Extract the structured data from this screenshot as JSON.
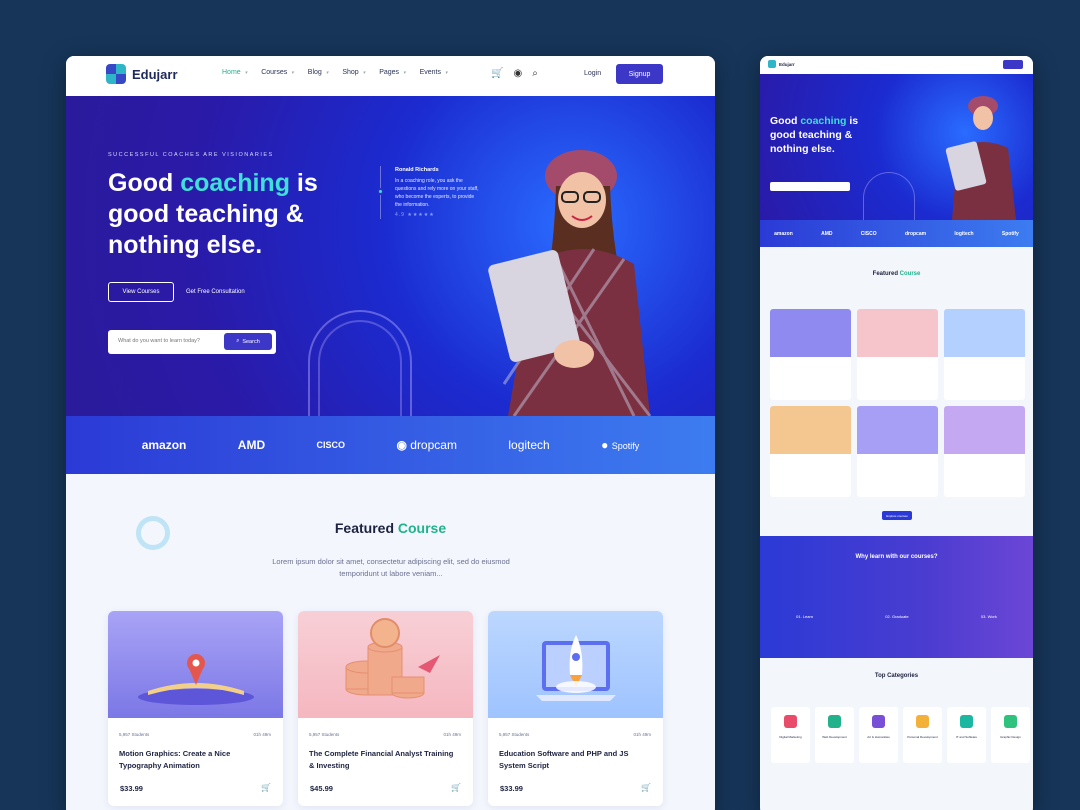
{
  "nav": {
    "logo": "Edujarr",
    "menu": [
      "Home",
      "Courses",
      "Blog",
      "Shop",
      "Pages",
      "Events"
    ],
    "login": "Login",
    "signup": "Signup"
  },
  "hero": {
    "eyebrow": "SUCCESSFUL COACHES ARE VISIONARIES",
    "title_1": "Good ",
    "title_accent": "coaching",
    "title_2": " is good teaching & nothing else.",
    "btn_view": "View Courses",
    "btn_consult": "Get Free Consultation",
    "search_placeholder": "What do you want to learn today?",
    "search_btn": "Search",
    "testimonial_name": "Ronald Richards",
    "testimonial_text": "In a coaching role, you ask the questions and rely more on your staff, who become the experts, to provide the information.",
    "testimonial_rating": "4.9"
  },
  "brands": [
    "amazon",
    "AMD",
    "CISCO",
    "dropcam",
    "logitech",
    "Spotify"
  ],
  "featured": {
    "title_1": "Featured ",
    "title_accent": "Course",
    "subtitle": "Lorem ipsum dolor sit amet, consectetur adipiscing elit, sed do eiusmod temporidunt ut labore veniam...",
    "cards": [
      {
        "students": "5,957 Students",
        "duration": "01h 49m",
        "title": "Motion Graphics: Create a Nice Typography Animation",
        "price": "$33.99"
      },
      {
        "students": "5,957 Students",
        "duration": "01h 49m",
        "title": "The Complete Financial Analyst Training & Investing",
        "price": "$45.99"
      },
      {
        "students": "5,957 Students",
        "duration": "01h 49m",
        "title": "Education Software and PHP and JS System Script",
        "price": "$33.99"
      }
    ]
  },
  "mobile": {
    "why_title": "Why learn with our courses?",
    "why_items": [
      "01. Learn",
      "02. Graduate",
      "03. Work"
    ],
    "categories_title": "Top Categories",
    "categories": [
      "Digital Marketing",
      "Web Development",
      "Art & Humanities",
      "Personal Development",
      "IT and Software",
      "Graphic Design"
    ],
    "explore": "Explore courses"
  },
  "colors": {
    "accent": "#3d37c8",
    "teal": "#21b28c",
    "hero": "#1b2bd0",
    "background": "#163559"
  }
}
